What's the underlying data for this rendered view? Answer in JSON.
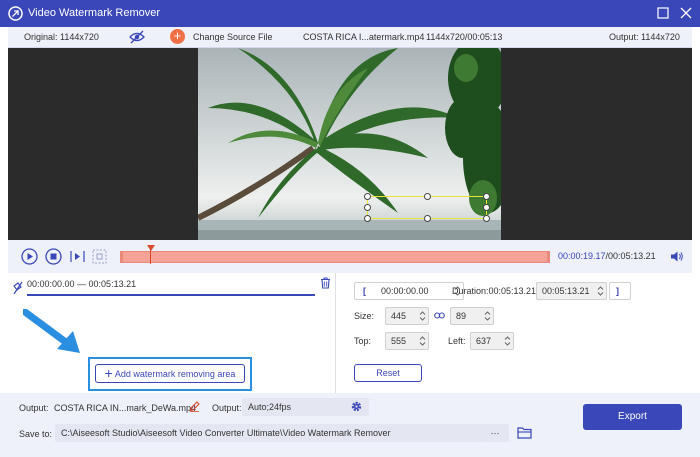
{
  "window": {
    "title": "Video Watermark Remover"
  },
  "infobar": {
    "original": "Original: 1144x720",
    "change_source": "Change Source File",
    "file_name": "COSTA RICA I...atermark.mp4",
    "file_info": "1144x720/00:05:13",
    "output": "Output: 1144x720"
  },
  "player": {
    "current_time": "00:00:19.17",
    "total_time": "/00:05:13.21"
  },
  "segment": {
    "range": "00:00:00.00 — 00:05:13.21"
  },
  "add_area_label": "Add watermark removing area",
  "clip": {
    "open_bracket": "[",
    "start": "00:00:00.00",
    "duration": "Duration:00:05:13.21",
    "end": "00:05:13.21",
    "close_bracket": "]"
  },
  "size": {
    "label": "Size:",
    "width": "445",
    "height": "89"
  },
  "position": {
    "top_label": "Top:",
    "top": "555",
    "left_label": "Left:",
    "left": "637"
  },
  "reset_label": "Reset",
  "footer": {
    "output_label": "Output:",
    "output_file": "COSTA RICA IN...mark_DeWa.mp4",
    "output_format_label": "Output:",
    "output_format": "Auto;24fps",
    "save_to_label": "Save to:",
    "save_path": "C:\\Aiseesoft Studio\\Aiseesoft Video Converter Ultimate\\Video Watermark Remover",
    "browse": "···",
    "export_label": "Export"
  },
  "colors": {
    "accent": "#3a47b8",
    "timeline": "#f4a396",
    "highlight": "#2a8fe0",
    "change_source_icon": "#f07045"
  },
  "icons": {
    "app": "app-logo-icon",
    "preview_toggle": "eye-icon",
    "play": "play-icon",
    "stop": "stop-icon",
    "next_frame": "next-frame-icon",
    "clip_mode": "clip-icon",
    "volume": "volume-icon",
    "delete": "trash-icon",
    "link": "link-icon",
    "edit": "pencil-icon",
    "settings": "gear-icon",
    "folder": "folder-icon"
  }
}
